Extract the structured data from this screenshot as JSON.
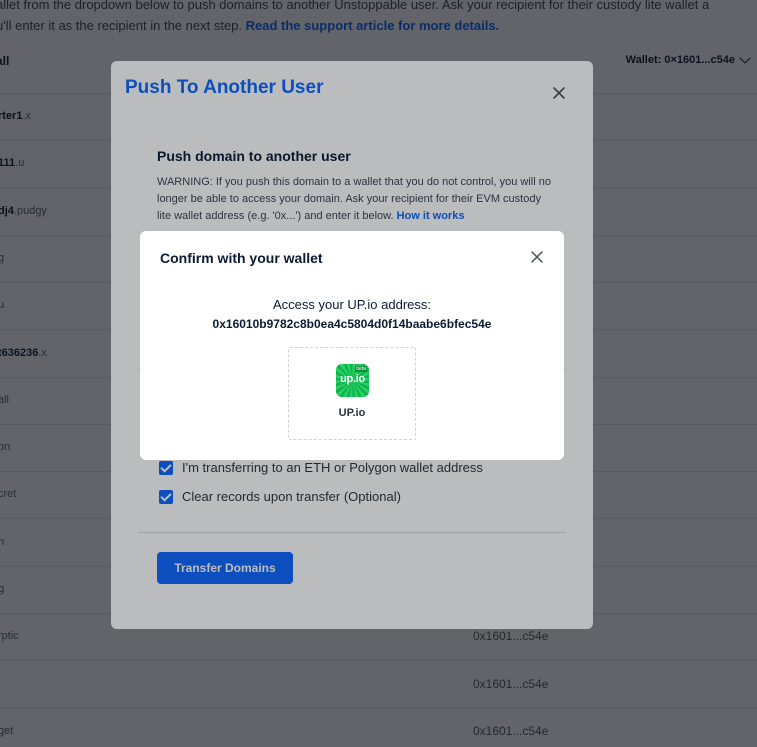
{
  "background": {
    "intro_line1": "allet from the dropdown below to push domains to another Unstoppable user. Ask your recipient for their custody lite wallet a",
    "intro_line2_text": "u'll enter it as the recipient in the next step. ",
    "intro_line2_link": "Read the support article for more details.",
    "column_header": "all",
    "wallet_selector": "Wallet: 0×1601...c54e",
    "rows": [
      {
        "name": "rter1",
        "ext": ".x",
        "wallet": ""
      },
      {
        "name": "111",
        "ext": ".u",
        "wallet": ""
      },
      {
        "name": "dj4",
        "ext": ".pudgy",
        "wallet": ""
      },
      {
        "name": "",
        "ext": "g",
        "wallet": ""
      },
      {
        "name": "",
        "ext": "u",
        "wallet": ""
      },
      {
        "name": "t636236",
        "ext": ".x",
        "wallet": ""
      },
      {
        "name": "",
        "ext": "all",
        "wallet": ""
      },
      {
        "name": "",
        "ext": "pn",
        "wallet": ""
      },
      {
        "name": "",
        "ext": "cret",
        "wallet": ""
      },
      {
        "name": "",
        "ext": "n",
        "wallet": ""
      },
      {
        "name": "",
        "ext": "g",
        "wallet": ""
      },
      {
        "name": "",
        "ext": "rptic",
        "wallet": "0x1601...c54e"
      },
      {
        "name": "",
        "ext": "",
        "wallet": "0x1601...c54e"
      },
      {
        "name": "",
        "ext": "get",
        "wallet": "0x1601...c54e"
      }
    ]
  },
  "push_dialog": {
    "title": "Push To Another User",
    "section_title": "Push domain to another user",
    "warning": "WARNING: If you push this domain to a wallet that you do not control, you will no longer be able to access your domain. Ask your recipient for their EVM custody lite wallet address (e.g. '0x...') and enter it below.",
    "how_it_works": "How it works",
    "checkbox_eth": "I'm transferring to an ETH or Polygon wallet address",
    "checkbox_clear": "Clear records upon transfer (Optional)",
    "transfer_button": "Transfer Domains"
  },
  "confirm_dialog": {
    "title": "Confirm with your wallet",
    "access_label": "Access your UP.io address:",
    "address": "0x16010b9782c8b0ea4c5804d0f14baabe6bfec54e",
    "wallet_option": {
      "logo_text": "up.io",
      "logo_badge": "beta",
      "label": "UP.io",
      "icon": "upio-logo-icon"
    }
  },
  "colors": {
    "accent": "#0d67fe",
    "logo_green": "#1fc35a"
  }
}
